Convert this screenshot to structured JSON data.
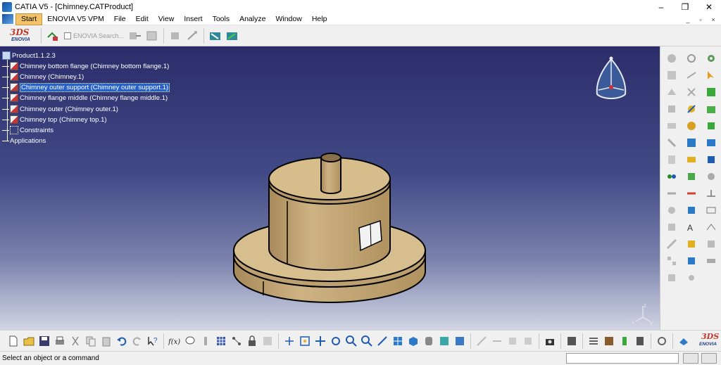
{
  "window": {
    "title": "CATIA V5 - [Chimney.CATProduct]",
    "controls": {
      "minimize": "–",
      "maximize": "❐",
      "close": "✕"
    }
  },
  "menubar": {
    "items": [
      "Start",
      "ENOVIA V5 VPM",
      "File",
      "Edit",
      "View",
      "Insert",
      "Tools",
      "Analyze",
      "Window",
      "Help"
    ],
    "active": "Start",
    "mdi_controls": {
      "minimize": "_",
      "restore": "▫",
      "close": "×"
    }
  },
  "enovia_toolbar": {
    "logo_ds": "3DS",
    "logo_text": "ENOVIA",
    "search_label": "ENOVIA Search..."
  },
  "tree": {
    "root": "Product1.1.2.3",
    "items": [
      {
        "label": "Chimney bottom flange (Chimney bottom flange.1)",
        "selected": false
      },
      {
        "label": "Chimney (Chimney.1)",
        "selected": false
      },
      {
        "label": "Chimney outer support (Chimney outer support.1)",
        "selected": true
      },
      {
        "label": "Chimney flange middle (Chimney flange middle.1)",
        "selected": false
      },
      {
        "label": "Chimney outer (Chimney outer.1)",
        "selected": false
      },
      {
        "label": "Chimney top (Chimney top.1)",
        "selected": false
      }
    ],
    "constraints": "Constraints",
    "applications": "Applications"
  },
  "axis_labels": {
    "x": "x",
    "y": "y",
    "z": "z"
  },
  "bottom_toolbar": {
    "formula_label": "f(x)",
    "logo_ds": "3DS",
    "logo_text": "ENOVIA"
  },
  "status": {
    "message": "Select an object or a command",
    "command_input_value": ""
  },
  "colors": {
    "viewport_top": "#2c2d6b",
    "viewport_bottom": "#d2d4e4",
    "part_fill": "#d8bd8c",
    "selection": "#2862c8",
    "menu_active": "#f3c36a"
  }
}
